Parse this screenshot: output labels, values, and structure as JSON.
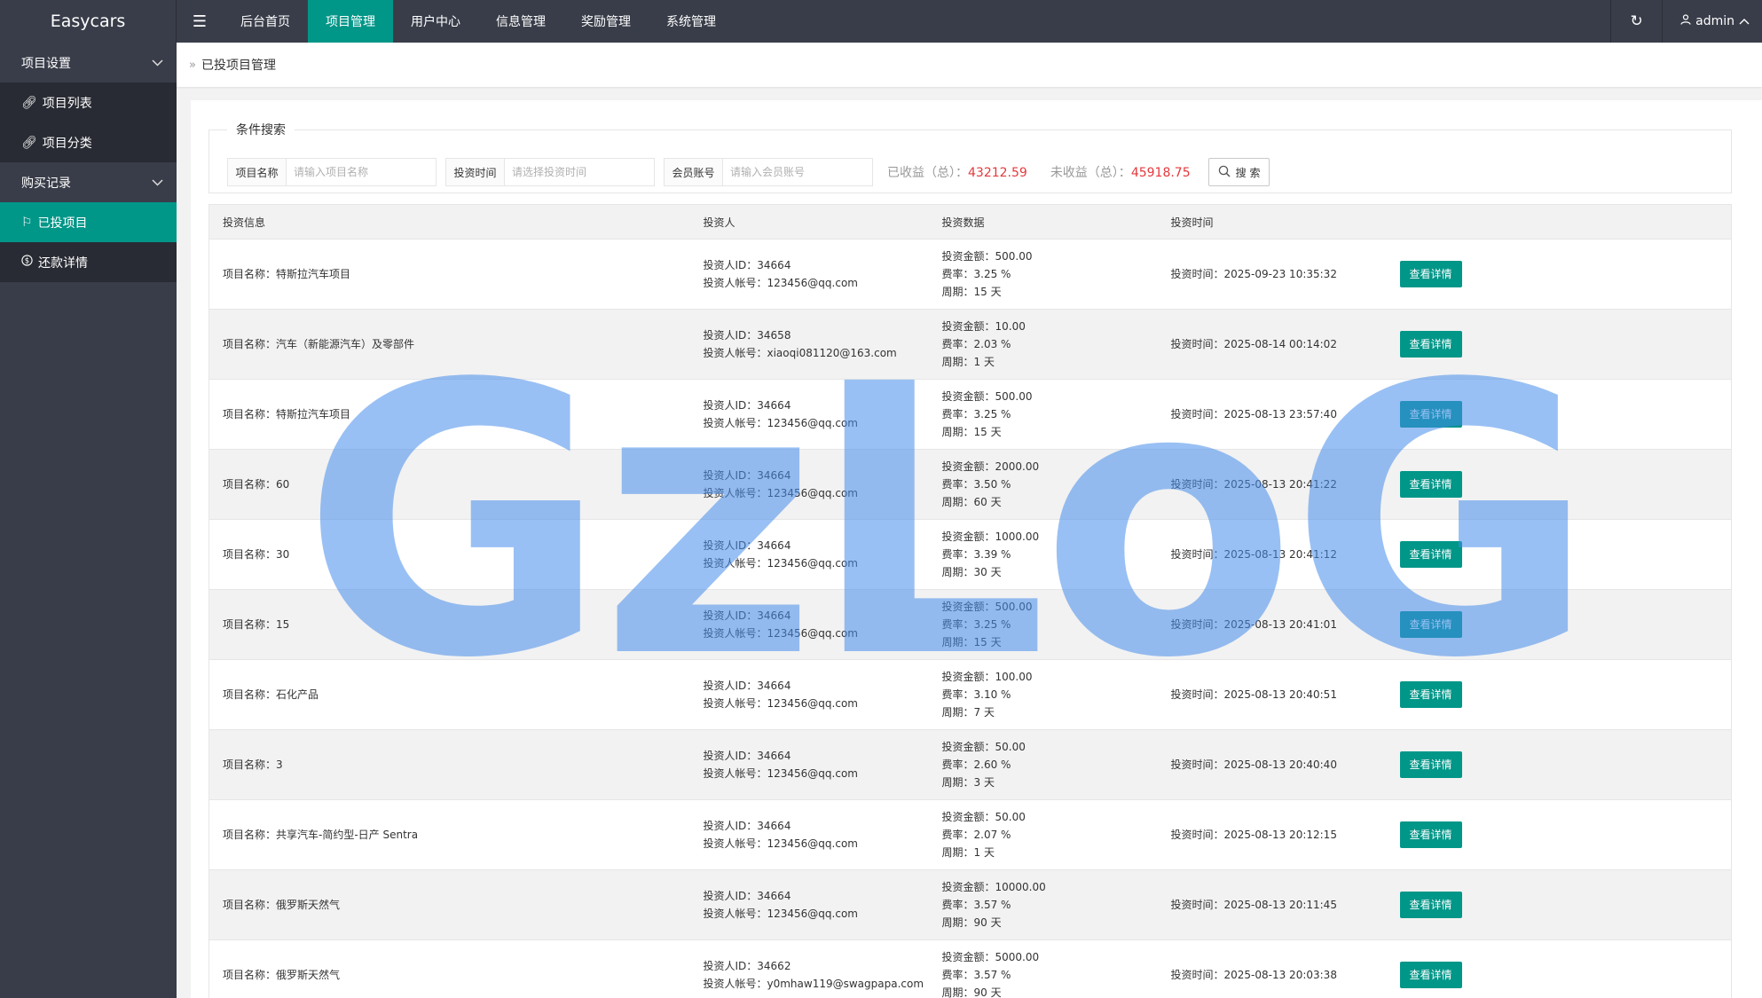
{
  "app": {
    "title": "Easycars"
  },
  "topnav": {
    "items": [
      {
        "label": "后台首页",
        "active": false
      },
      {
        "label": "项目管理",
        "active": true
      },
      {
        "label": "用户中心",
        "active": false
      },
      {
        "label": "信息管理",
        "active": false
      },
      {
        "label": "奖励管理",
        "active": false
      },
      {
        "label": "系统管理",
        "active": false
      }
    ],
    "user": "admin"
  },
  "sidebar": {
    "group1": "项目设置",
    "group1_items": [
      "项目列表",
      "项目分类"
    ],
    "group2": "购买记录",
    "group2_items": [
      "已投项目",
      "还款详情"
    ]
  },
  "breadcrumb": "已投项目管理",
  "search": {
    "legend": "条件搜索",
    "project_label": "项目名称",
    "project_placeholder": "请输入项目名称",
    "time_label": "投资时间",
    "time_placeholder": "请选择投资时间",
    "member_label": "会员账号",
    "member_placeholder": "请输入会员账号",
    "earned_label": "已收益（总）：",
    "earned_value": "43212.59",
    "pending_label": "未收益（总）：",
    "pending_value": "45918.75",
    "button": "搜 索"
  },
  "table": {
    "headers": [
      "投资信息",
      "投资人",
      "投资数据",
      "投资时间",
      ""
    ],
    "detail_label": "查看详情",
    "rows": [
      {
        "project": "项目名称：特斯拉汽车项目",
        "uid": "投资人ID：34664",
        "account": "投资人帐号：123456@qq.com",
        "amount": "投资金额：500.00",
        "rate": "费率：3.25 %",
        "period": "周期：15 天",
        "time": "投资时间：2025-09-23 10:35:32"
      },
      {
        "project": "项目名称：汽车（新能源汽车）及零部件",
        "uid": "投资人ID：34658",
        "account": "投资人帐号：xiaoqi081120@163.com",
        "amount": "投资金额：10.00",
        "rate": "费率：2.03 %",
        "period": "周期：1 天",
        "time": "投资时间：2025-08-14 00:14:02"
      },
      {
        "project": "项目名称：特斯拉汽车项目",
        "uid": "投资人ID：34664",
        "account": "投资人帐号：123456@qq.com",
        "amount": "投资金额：500.00",
        "rate": "费率：3.25 %",
        "period": "周期：15 天",
        "time": "投资时间：2025-08-13 23:57:40"
      },
      {
        "project": "项目名称：60",
        "uid": "投资人ID：34664",
        "account": "投资人帐号：123456@qq.com",
        "amount": "投资金额：2000.00",
        "rate": "费率：3.50 %",
        "period": "周期：60 天",
        "time": "投资时间：2025-08-13 20:41:22"
      },
      {
        "project": "项目名称：30",
        "uid": "投资人ID：34664",
        "account": "投资人帐号：123456@qq.com",
        "amount": "投资金额：1000.00",
        "rate": "费率：3.39 %",
        "period": "周期：30 天",
        "time": "投资时间：2025-08-13 20:41:12"
      },
      {
        "project": "项目名称：15",
        "uid": "投资人ID：34664",
        "account": "投资人帐号：123456@qq.com",
        "amount": "投资金额：500.00",
        "rate": "费率：3.25 %",
        "period": "周期：15 天",
        "time": "投资时间：2025-08-13 20:41:01"
      },
      {
        "project": "项目名称：石化产品",
        "uid": "投资人ID：34664",
        "account": "投资人帐号：123456@qq.com",
        "amount": "投资金额：100.00",
        "rate": "费率：3.10 %",
        "period": "周期：7 天",
        "time": "投资时间：2025-08-13 20:40:51"
      },
      {
        "project": "项目名称：3",
        "uid": "投资人ID：34664",
        "account": "投资人帐号：123456@qq.com",
        "amount": "投资金额：50.00",
        "rate": "费率：2.60 %",
        "period": "周期：3 天",
        "time": "投资时间：2025-08-13 20:40:40"
      },
      {
        "project": "项目名称：共享汽车-简约型-日产 Sentra",
        "uid": "投资人ID：34664",
        "account": "投资人帐号：123456@qq.com",
        "amount": "投资金额：50.00",
        "rate": "费率：2.07 %",
        "period": "周期：1 天",
        "time": "投资时间：2025-08-13 20:12:15"
      },
      {
        "project": "项目名称：俄罗斯天然气",
        "uid": "投资人ID：34664",
        "account": "投资人帐号：123456@qq.com",
        "amount": "投资金额：10000.00",
        "rate": "费率：3.57 %",
        "period": "周期：90 天",
        "time": "投资时间：2025-08-13 20:11:45"
      },
      {
        "project": "项目名称：俄罗斯天然气",
        "uid": "投资人ID：34662",
        "account": "投资人帐号：y0mhaw119@swagpapa.com",
        "amount": "投资金额：5000.00",
        "rate": "费率：3.57 %",
        "period": "周期：90 天",
        "time": "投资时间：2025-08-13 20:03:38"
      }
    ]
  },
  "watermark": "GzLoG",
  "colors": {
    "accent": "#009688",
    "topbar": "#393d49",
    "money": "#e4393c",
    "watermark": "#468ceb"
  }
}
